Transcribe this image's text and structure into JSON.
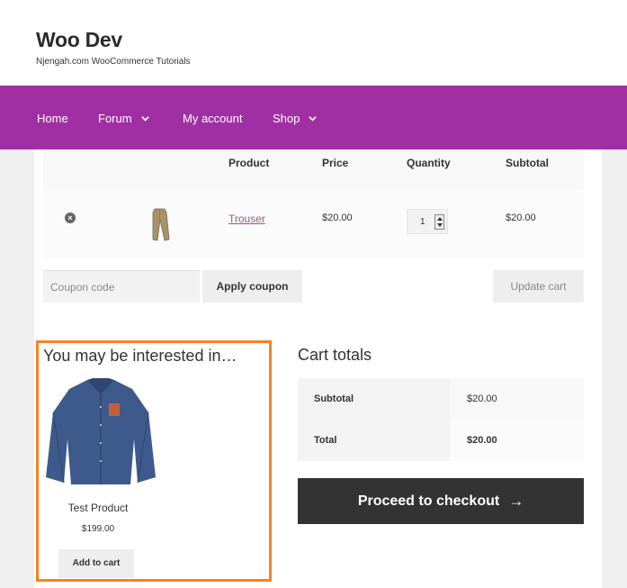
{
  "site": {
    "title": "Woo Dev",
    "tagline": "Njengah.com WooCommerce Tutorials"
  },
  "nav": {
    "items": [
      {
        "label": "Home"
      },
      {
        "label": "Forum",
        "has_dropdown": true
      },
      {
        "label": "My account"
      },
      {
        "label": "Shop",
        "has_dropdown": true
      }
    ]
  },
  "colors": {
    "nav_bg": "#a12fa4",
    "highlight_border": "#f5841f",
    "checkout_bg": "#333333",
    "link": "#96588a"
  },
  "cart": {
    "headers": {
      "product": "Product",
      "price": "Price",
      "quantity": "Quantity",
      "subtotal": "Subtotal"
    },
    "row": {
      "remove_icon": "remove-x-icon",
      "name": "Trouser",
      "price": "$20.00",
      "quantity": "1",
      "subtotal": "$20.00"
    },
    "coupon_placeholder": "Coupon code",
    "apply_label": "Apply coupon",
    "update_label": "Update cart"
  },
  "cross_sells": {
    "title": "You may be interested in…",
    "product": {
      "name": "Test Product",
      "price": "$199.00",
      "button": "Add to cart"
    }
  },
  "totals": {
    "title": "Cart totals",
    "subtotal_label": "Subtotal",
    "subtotal_value": "$20.00",
    "total_label": "Total",
    "total_value": "$20.00",
    "checkout_label": "Proceed to checkout",
    "checkout_icon": "→"
  }
}
